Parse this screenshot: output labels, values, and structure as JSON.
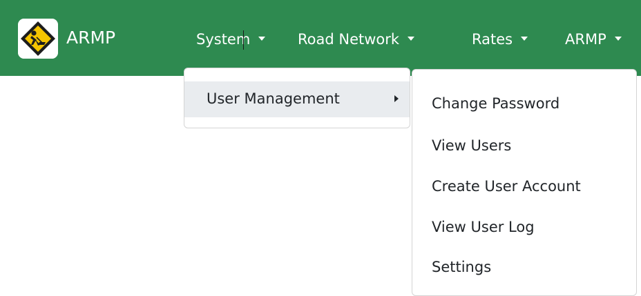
{
  "app": {
    "brand": "ARMP"
  },
  "nav": {
    "items": [
      {
        "label": "System"
      },
      {
        "label": "Road Network"
      },
      {
        "label": "Rates"
      },
      {
        "label": "ARMP"
      }
    ]
  },
  "system_menu": {
    "items": [
      {
        "label": "User Management",
        "highlighted": true,
        "has_submenu": true
      }
    ]
  },
  "user_management_menu": {
    "items": [
      {
        "label": "Change Password"
      },
      {
        "label": "View Users"
      },
      {
        "label": "Create User Account"
      },
      {
        "label": "View User Log"
      },
      {
        "label": "Settings"
      }
    ]
  },
  "colors": {
    "navbar": "#2e8a50",
    "highlight": "#e9ecef",
    "menu_text": "#212529",
    "nav_text": "#ffffff"
  },
  "icons": {
    "logo": "road-worker-sign-icon",
    "nav_caret": "caret-down-icon",
    "submenu_caret": "caret-right-icon"
  }
}
